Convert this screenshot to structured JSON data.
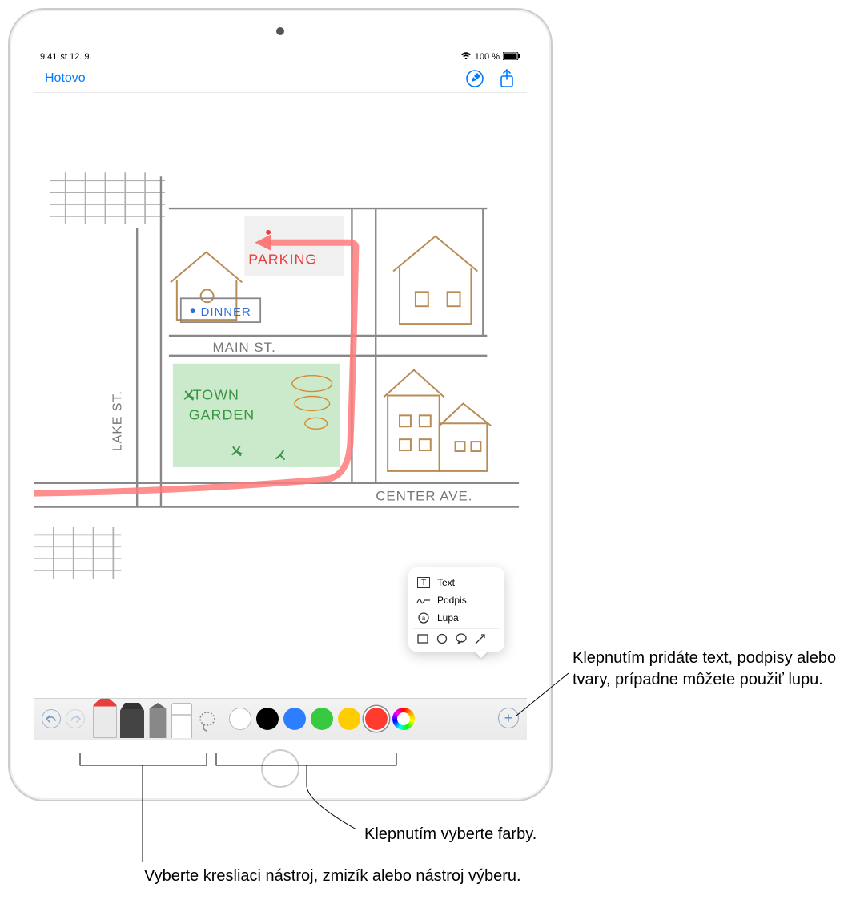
{
  "status_bar": {
    "time": "9:41",
    "date": "st 12. 9.",
    "battery_text": "100 %"
  },
  "nav": {
    "done_label": "Hotovo"
  },
  "popup": {
    "text_label": "Text",
    "signature_label": "Podpis",
    "magnifier_label": "Lupa"
  },
  "sketch": {
    "parking": "PARKING",
    "dinner": "DINNER",
    "main_st": "MAIN ST.",
    "lake_st": "LAKE ST.",
    "town_garden_1": "TOWN",
    "town_garden_2": "GARDEN",
    "center_ave": "CENTER AVE."
  },
  "colors": {
    "white": "#ffffff",
    "black": "#000000",
    "blue": "#2d7eff",
    "green": "#37c93f",
    "yellow": "#ffcc00",
    "red": "#ff3b30"
  },
  "callouts": {
    "plus": "Klepnutím pridáte text, podpisy alebo tvary, prípadne môžete použiť lupu.",
    "colors": "Klepnutím vyberte farby.",
    "tools": "Vyberte kresliaci nástroj, zmizík alebo nástroj výberu."
  }
}
